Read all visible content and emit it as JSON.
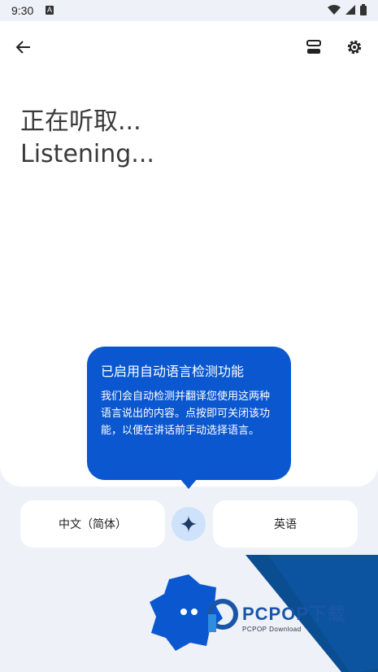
{
  "status_bar": {
    "time": "9:30",
    "notif_icon": "A"
  },
  "toolbar": {
    "back_icon": "arrow-left-icon",
    "history_icon": "history-icon",
    "settings_icon": "gear-icon"
  },
  "transcript": {
    "line_zh": "正在听取...",
    "line_en": "Listening..."
  },
  "tooltip": {
    "title": "已启用自动语言检测功能",
    "body": "我们会自动检测并翻译您使用这两种语言说出的内容。点按即可关闭该功能，以便在讲话前手动选择语言。"
  },
  "languages": {
    "left": "中文（简体）",
    "right": "英语"
  },
  "watermark": {
    "brand": "PCPOP下载",
    "sub": "PCPOP Download"
  },
  "colors": {
    "accent": "#0b57d0",
    "swap_bg": "#cfe2fb",
    "deco_blue": "#0a4d91"
  }
}
